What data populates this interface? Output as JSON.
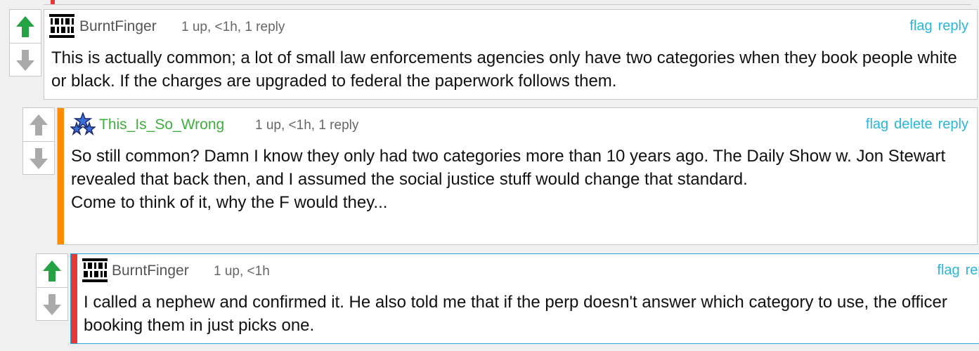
{
  "comments": [
    {
      "username": "BurntFinger",
      "meta": "1 up, <1h, 1 reply",
      "actions": {
        "flag": "flag",
        "reply": "reply"
      },
      "body": "This is actually common; a lot of small law enforcements agencies only have two categories when they book people white or black. If the charges are upgraded to federal the paperwork follows them.",
      "upvoted": true
    },
    {
      "username": "This_Is_So_Wrong",
      "meta": "1 up, <1h, 1 reply",
      "actions": {
        "flag": "flag",
        "delete": "delete",
        "reply": "reply"
      },
      "body": "So still common? Damn I know they only had two categories more than 10 years ago. The Daily Show w. Jon Stewart revealed that back then, and I assumed the social justice stuff would change that standard.\nCome to think of it, why the F would they...",
      "upvoted": false
    },
    {
      "username": "BurntFinger",
      "meta": "1 up, <1h",
      "actions": {
        "flag": "flag",
        "reply": "reply"
      },
      "body": "I called a nephew and confirmed it. He also told me that if the perp doesn't answer which category to use, the officer booking them in just picks one.",
      "upvoted": true
    }
  ],
  "colors": {
    "upvote_active": "#25a244",
    "vote_inactive": "#aaaaaa",
    "link": "#29b6d8",
    "username_default": "#555555",
    "username_self": "#3fae3f",
    "stripe_orange": "#ff8c00",
    "stripe_red": "#e53935"
  },
  "icons": {
    "upvote": "arrow-up-icon",
    "downvote": "arrow-down-icon",
    "avatar_binary": "binary-avatar-icon",
    "avatar_stars": "stars-avatar-icon"
  }
}
